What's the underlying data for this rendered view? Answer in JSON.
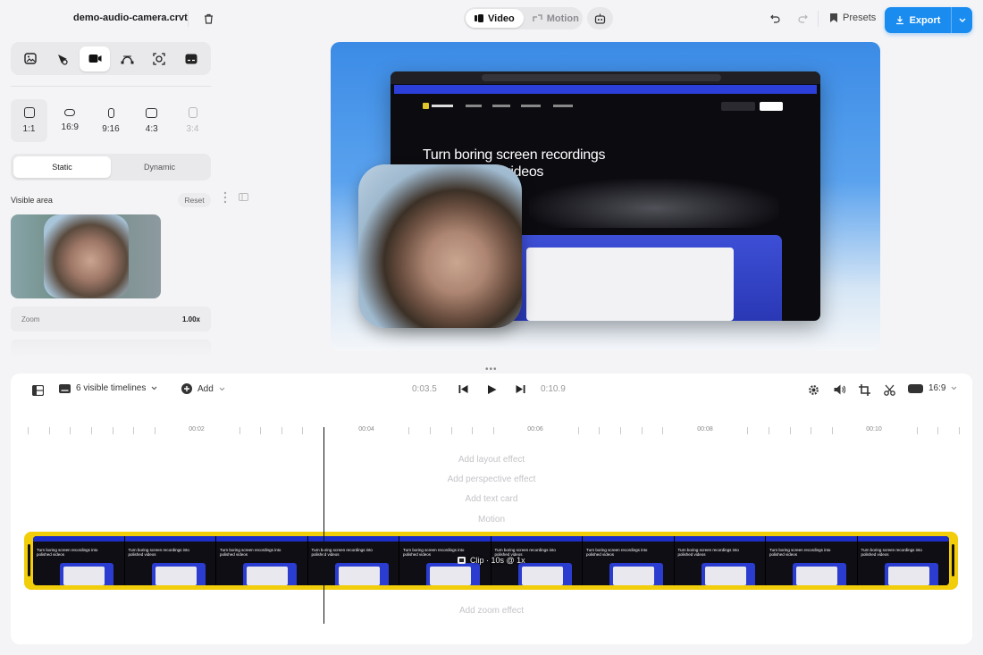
{
  "header": {
    "filename": "demo-audio-camera.crvt",
    "mode_tabs": [
      {
        "label": "Video",
        "active": true
      },
      {
        "label": "Motion",
        "active": false
      }
    ],
    "presets_label": "Presets",
    "export_label": "Export"
  },
  "left_panel": {
    "tools": [
      "image-icon",
      "cursor-icon",
      "camera-icon",
      "bezier-icon",
      "focus-icon",
      "caption-icon"
    ],
    "active_tool": "camera-icon",
    "aspect_ratios": [
      {
        "label": "1:1",
        "active": true
      },
      {
        "label": "16:9",
        "active": false
      },
      {
        "label": "9:16",
        "active": false
      },
      {
        "label": "4:3",
        "active": false
      },
      {
        "label": "3:4",
        "active": false,
        "disabled": true
      }
    ],
    "modes": [
      {
        "label": "Static",
        "active": true
      },
      {
        "label": "Dynamic",
        "active": false
      }
    ],
    "visible_area_label": "Visible area",
    "reset_label": "Reset",
    "zoom_label": "Zoom",
    "zoom_value": "1.00x"
  },
  "preview": {
    "hero_text": "Turn boring screen recordings into beautiful videos"
  },
  "timeline": {
    "timelines_label": "6 visible timelines",
    "add_label": "Add",
    "current_time": "0:03.5",
    "total_time": "0:10.9",
    "aspect_label": "16:9",
    "ruler_labels": [
      "00:02",
      "00:04",
      "00:06",
      "00:08",
      "00:10"
    ],
    "add_layout": "Add layout effect",
    "add_perspective": "Add perspective effect",
    "add_text": "Add text card",
    "motion": "Motion",
    "clip_label": "Clip · 10s @ 1x",
    "add_zoom": "Add zoom effect",
    "frame_caption": "Turn boring screen recordings into polished videos"
  },
  "colors": {
    "accent": "#1a8cf0",
    "clip_border": "#f2cd0a"
  }
}
